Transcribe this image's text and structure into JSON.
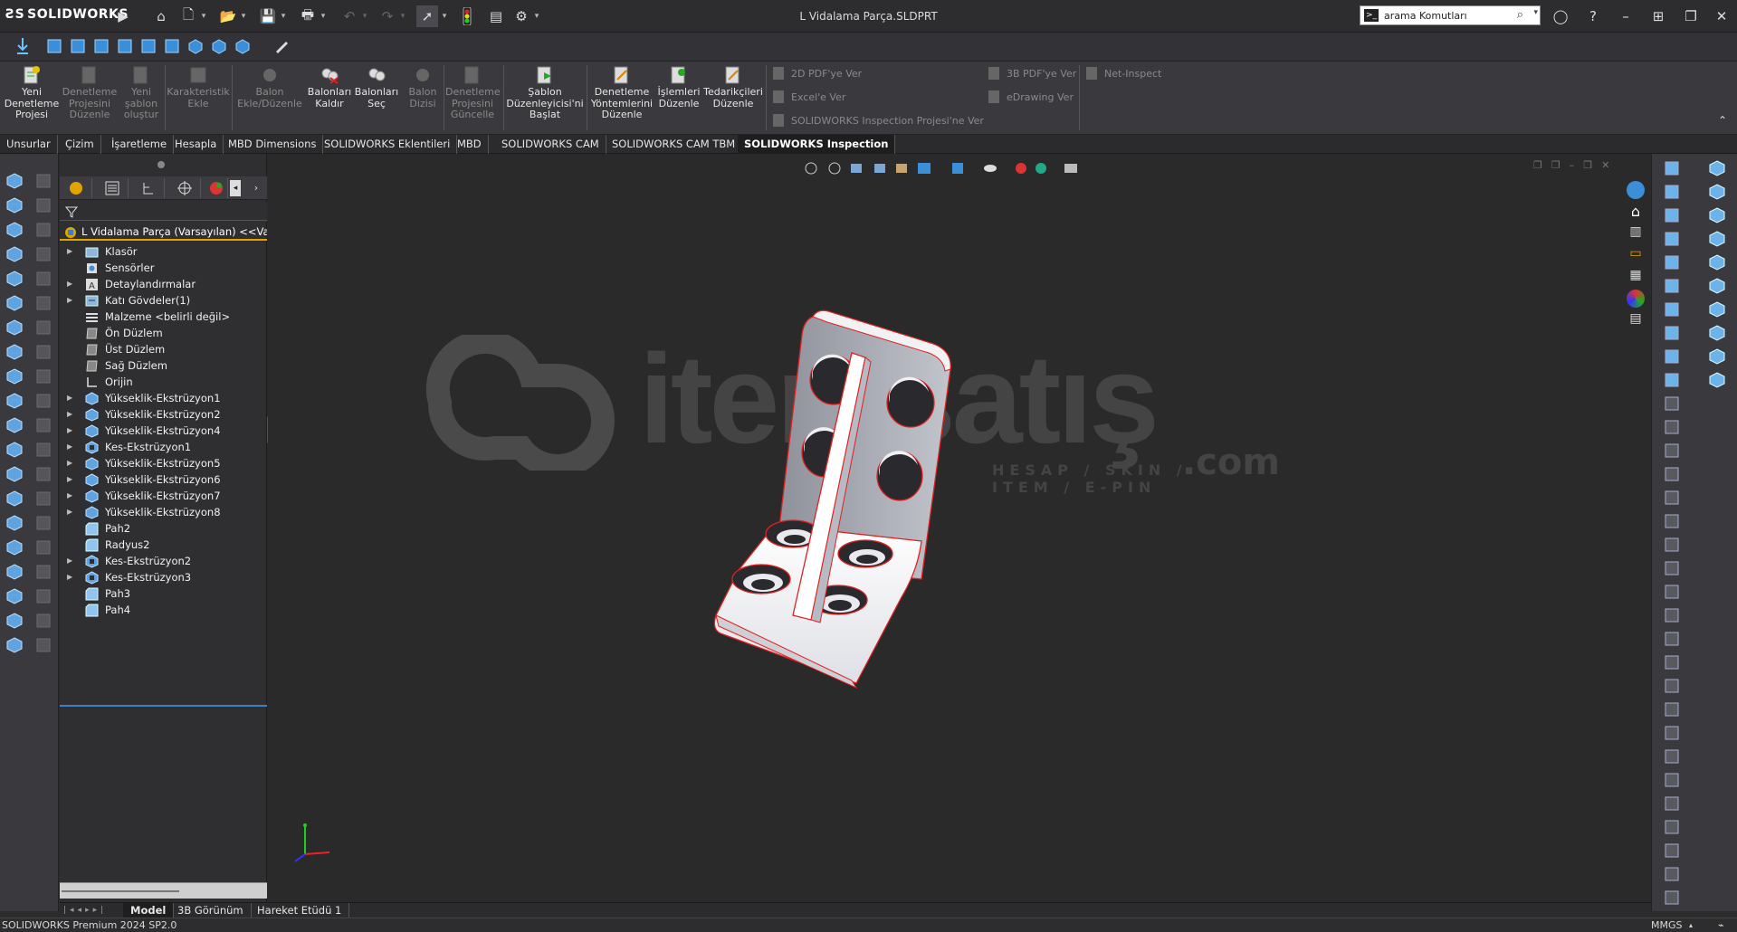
{
  "app": {
    "brand": "SOLIDWORKS",
    "document_title": "L Vidalama Parça.SLDPRT"
  },
  "search": {
    "placeholder": "arama Komutları"
  },
  "command_manager": {
    "items": [
      {
        "label": "Yeni Denetleme Projesi",
        "enabled": true
      },
      {
        "label": "Denetleme Projesini Düzenle",
        "enabled": false
      },
      {
        "label": "Yeni şablon oluştur",
        "enabled": false
      },
      {
        "label": "Karakteristik Ekle",
        "enabled": false
      },
      {
        "label": "Balon Ekle/Düzenle",
        "enabled": false
      },
      {
        "label": "Balonları Kaldır",
        "enabled": true
      },
      {
        "label": "Balonları Seç",
        "enabled": true
      },
      {
        "label": "Balon Dizisi",
        "enabled": false
      },
      {
        "label": "Denetleme Projesini Güncelle",
        "enabled": false
      },
      {
        "label": "Şablon Düzenleyicisi'ni Başlat",
        "enabled": true
      },
      {
        "label": "Denetleme Yöntemlerini Düzenle",
        "enabled": true
      },
      {
        "label": "İşlemleri Düzenle",
        "enabled": true
      },
      {
        "label": "Tedarikçileri Düzenle",
        "enabled": true
      }
    ],
    "export": {
      "pdf2d": "2D PDF'ye Ver",
      "excel": "Excel'e Ver",
      "inspection_project": "SOLIDWORKS Inspection Projesi'ne Ver",
      "pdf3d": "3B PDF'ye Ver",
      "edrawing": "eDrawing Ver",
      "net_inspect": "Net-Inspect"
    }
  },
  "tabs": [
    {
      "label": "Unsurlar",
      "active": false
    },
    {
      "label": "Çizim",
      "active": false
    },
    {
      "label": "İşaretleme",
      "active": false
    },
    {
      "label": "Hesapla",
      "active": false
    },
    {
      "label": "MBD Dimensions",
      "active": false
    },
    {
      "label": "SOLIDWORKS Eklentileri",
      "active": false
    },
    {
      "label": "MBD",
      "active": false
    },
    {
      "label": "SOLIDWORKS CAM",
      "active": false
    },
    {
      "label": "SOLIDWORKS CAM TBM",
      "active": false
    },
    {
      "label": "SOLIDWORKS Inspection",
      "active": true
    }
  ],
  "feature_tree": {
    "root": "L Vidalama Parça  (Varsayılan) <<Varsa",
    "items": [
      {
        "label": "Klasör",
        "expandable": true,
        "icon": "folder-icon"
      },
      {
        "label": "Sensörler",
        "expandable": false,
        "icon": "sensor-icon"
      },
      {
        "label": "Detaylandırmalar",
        "expandable": true,
        "icon": "annotation-icon"
      },
      {
        "label": "Katı Gövdeler(1)",
        "expandable": true,
        "icon": "solid-bodies-icon"
      },
      {
        "label": "Malzeme <belirli değil>",
        "expandable": false,
        "icon": "material-icon"
      },
      {
        "label": "Ön Düzlem",
        "expandable": false,
        "icon": "plane-icon"
      },
      {
        "label": "Üst Düzlem",
        "expandable": false,
        "icon": "plane-icon"
      },
      {
        "label": "Sağ Düzlem",
        "expandable": false,
        "icon": "plane-icon"
      },
      {
        "label": "Orijin",
        "expandable": false,
        "icon": "origin-icon"
      },
      {
        "label": "Yükseklik-Ekstrüzyon1",
        "expandable": true,
        "icon": "extrude-icon"
      },
      {
        "label": "Yükseklik-Ekstrüzyon2",
        "expandable": true,
        "icon": "extrude-icon"
      },
      {
        "label": "Yükseklik-Ekstrüzyon4",
        "expandable": true,
        "icon": "extrude-icon"
      },
      {
        "label": "Kes-Ekstrüzyon1",
        "expandable": true,
        "icon": "cut-extrude-icon"
      },
      {
        "label": "Yükseklik-Ekstrüzyon5",
        "expandable": true,
        "icon": "extrude-icon"
      },
      {
        "label": "Yükseklik-Ekstrüzyon6",
        "expandable": true,
        "icon": "extrude-icon"
      },
      {
        "label": "Yükseklik-Ekstrüzyon7",
        "expandable": true,
        "icon": "extrude-icon"
      },
      {
        "label": "Yükseklik-Ekstrüzyon8",
        "expandable": true,
        "icon": "extrude-icon"
      },
      {
        "label": "Pah2",
        "expandable": false,
        "icon": "chamfer-icon"
      },
      {
        "label": "Radyus2",
        "expandable": false,
        "icon": "fillet-icon"
      },
      {
        "label": "Kes-Ekstrüzyon2",
        "expandable": true,
        "icon": "cut-extrude-icon"
      },
      {
        "label": "Kes-Ekstrüzyon3",
        "expandable": true,
        "icon": "cut-extrude-icon"
      },
      {
        "label": "Pah3",
        "expandable": false,
        "icon": "chamfer-icon"
      },
      {
        "label": "Pah4",
        "expandable": false,
        "icon": "chamfer-icon"
      }
    ]
  },
  "watermark": {
    "text": "itemsatış",
    "subtitle": "HESAP / SKIN / ITEM / E-PIN",
    "suffix": ".com"
  },
  "bottom_tabs": [
    {
      "label": "Model",
      "active": true
    },
    {
      "label": "3B Görünüm",
      "active": false
    },
    {
      "label": "Hareket Etüdü 1",
      "active": false
    }
  ],
  "status": {
    "version": "SOLIDWORKS Premium 2024 SP2.0",
    "units": "MMGS"
  },
  "colors": {
    "accent_orange": "#e0a300",
    "tree_end_line": "#3d7fc1",
    "model_edge": "#e02020",
    "viewport_bg": "#2a2a2a"
  }
}
